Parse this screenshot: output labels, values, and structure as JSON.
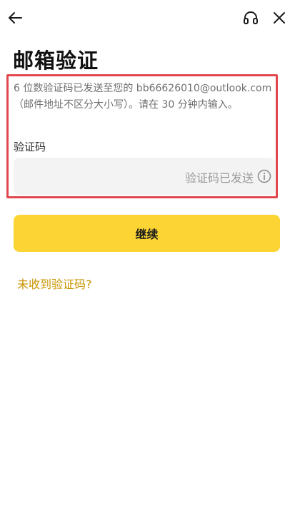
{
  "header": {
    "back_icon": "arrow-left-icon",
    "support_icon": "headset-icon",
    "close_icon": "close-icon"
  },
  "page": {
    "title": "邮箱验证"
  },
  "verification": {
    "description_line1": "6 位数验证码已发送至您的 bb66626010@outlook.com",
    "description_line2": "（邮件地址不区分大小写）。请在 30 分钟内输入。",
    "field_label": "验证码",
    "input_value": "",
    "status_text": "验证码已发送",
    "info_icon": "info-icon"
  },
  "actions": {
    "continue_label": "继续",
    "resend_label": "未收到验证码?"
  },
  "colors": {
    "accent": "#fcd535",
    "link": "#c99400",
    "highlight_border": "#e0474e",
    "input_bg": "#f3f3f3"
  }
}
